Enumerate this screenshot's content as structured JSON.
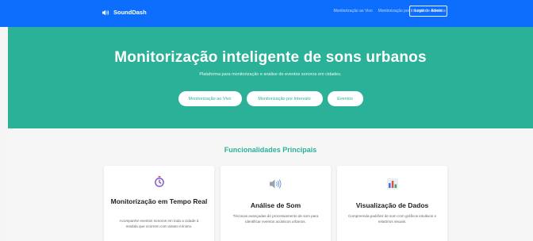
{
  "nav": {
    "brand": "SoundDash",
    "links": [
      "Monitorização ao Vivo",
      "Monitorização por Intervalo",
      "Eventos"
    ],
    "login": "Login de Admin",
    "color": "#0d6efd"
  },
  "hero": {
    "title": "Monitorização inteligente de sons urbanos",
    "subtitle": "Plataforma para monitorização e análise de eventos sonoros em cidades.",
    "buttons": [
      "Monitorização ao Vivo",
      "Monitorização por Intervalo",
      "Eventos"
    ],
    "color": "#2bb198"
  },
  "features": {
    "title": "Funcionalidades Principais",
    "cards": [
      {
        "icon": "stopwatch-icon",
        "title": "Monitorização em Tempo Real",
        "desc": "Acompanhe eventos sonoros em toda a cidade à medida que ocorrem com atraso mínimo."
      },
      {
        "icon": "speaker-icon",
        "title": "Análise de Som",
        "desc": "Técnicas avançadas de processamento de som para identificar eventos acústicos urbanos."
      },
      {
        "icon": "bar-chart-icon",
        "title": "Visualização de Dados",
        "desc": "Compreenda padrões de som com gráficos intuitivos e relatórios visuais."
      }
    ]
  }
}
